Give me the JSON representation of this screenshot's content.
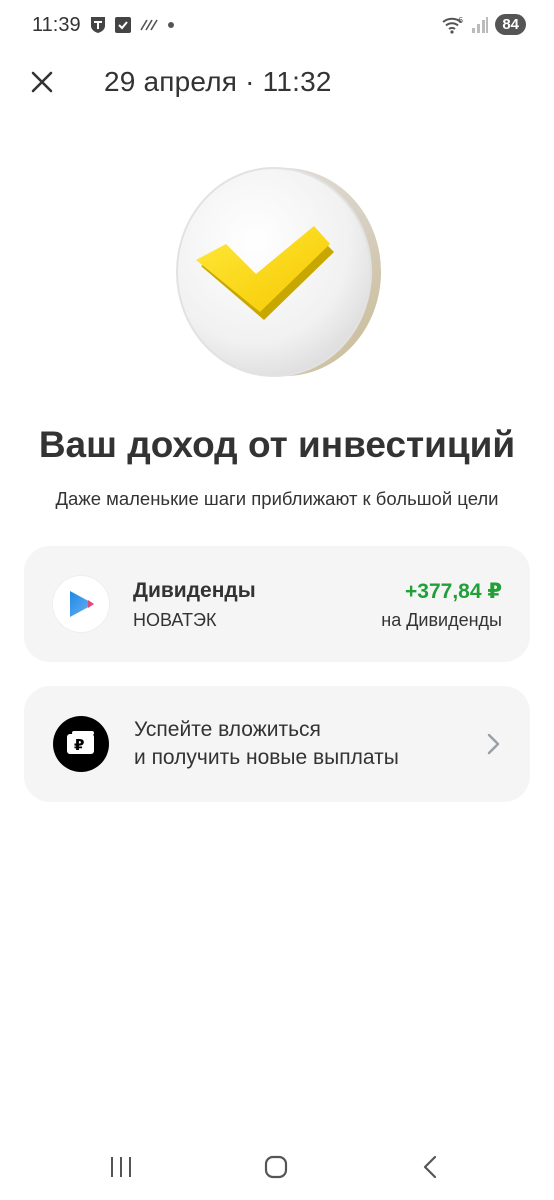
{
  "status_bar": {
    "time": "11:39",
    "battery": "84",
    "icons_left": [
      "tinkoff-t-icon",
      "checkbox-icon",
      "hatched-icon",
      "dot-icon"
    ],
    "icons_right": [
      "wifi-6-icon",
      "signal-icon",
      "battery-icon"
    ]
  },
  "header": {
    "title": "29 апреля · 11:32",
    "close_icon": "close-icon"
  },
  "hero": {
    "icon": "yellow-checkmark-coin-icon",
    "accent": "#ffdd2d"
  },
  "main": {
    "headline": "Ваш доход от инвестиций",
    "subline": "Даже маленькие шаги приближают к большой цели"
  },
  "dividends_card": {
    "title": "Дивиденды",
    "company": "НОВАТЭК",
    "amount": "+377,84 ₽",
    "destination": "на Дивиденды",
    "amount_color": "#21a038",
    "logo_icon": "novatek-logo-icon"
  },
  "promo_card": {
    "line1": "Успейте вложиться",
    "line2": "и получить новые выплаты",
    "icon": "ruble-wallet-icon"
  },
  "nav_bar": {
    "items": [
      "recent-apps-icon",
      "home-icon",
      "back-icon"
    ]
  },
  "colors": {
    "background": "#ffffff",
    "card_background": "#f5f5f6",
    "text": "#333333",
    "positive": "#21a038",
    "brand_yellow": "#ffdd2d"
  }
}
